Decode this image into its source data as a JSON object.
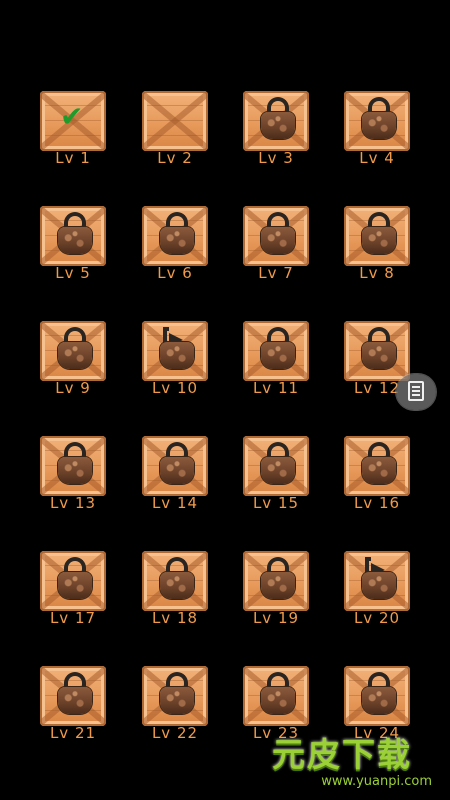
{
  "levels": [
    {
      "label": "Lv 1",
      "state": "completed"
    },
    {
      "label": "Lv 2",
      "state": "unlocked"
    },
    {
      "label": "Lv 3",
      "state": "locked"
    },
    {
      "label": "Lv 4",
      "state": "locked"
    },
    {
      "label": "Lv 5",
      "state": "locked"
    },
    {
      "label": "Lv 6",
      "state": "locked"
    },
    {
      "label": "Lv 7",
      "state": "locked"
    },
    {
      "label": "Lv 8",
      "state": "locked"
    },
    {
      "label": "Lv 9",
      "state": "locked"
    },
    {
      "label": "Lv 10",
      "state": "locked-open"
    },
    {
      "label": "Lv 11",
      "state": "locked"
    },
    {
      "label": "Lv 12",
      "state": "locked"
    },
    {
      "label": "Lv 13",
      "state": "locked"
    },
    {
      "label": "Lv 14",
      "state": "locked"
    },
    {
      "label": "Lv 15",
      "state": "locked"
    },
    {
      "label": "Lv 16",
      "state": "locked"
    },
    {
      "label": "Lv 17",
      "state": "locked"
    },
    {
      "label": "Lv 18",
      "state": "locked"
    },
    {
      "label": "Lv 19",
      "state": "locked"
    },
    {
      "label": "Lv 20",
      "state": "locked-open"
    },
    {
      "label": "Lv 21",
      "state": "locked"
    },
    {
      "label": "Lv 22",
      "state": "locked"
    },
    {
      "label": "Lv 23",
      "state": "locked"
    },
    {
      "label": "Lv 24",
      "state": "locked"
    }
  ],
  "icons": {
    "completed": "checkmark-icon",
    "locked": "padlock-icon",
    "locked-open": "open-padlock-icon",
    "side_menu": "document-icon"
  },
  "colors": {
    "background": "#000000",
    "label": "#ef9a4c",
    "check": "#1f9a2b",
    "crate": "#e79a5b"
  },
  "watermark": {
    "logo": "元皮下载",
    "url": "www.yuanpi.com"
  }
}
